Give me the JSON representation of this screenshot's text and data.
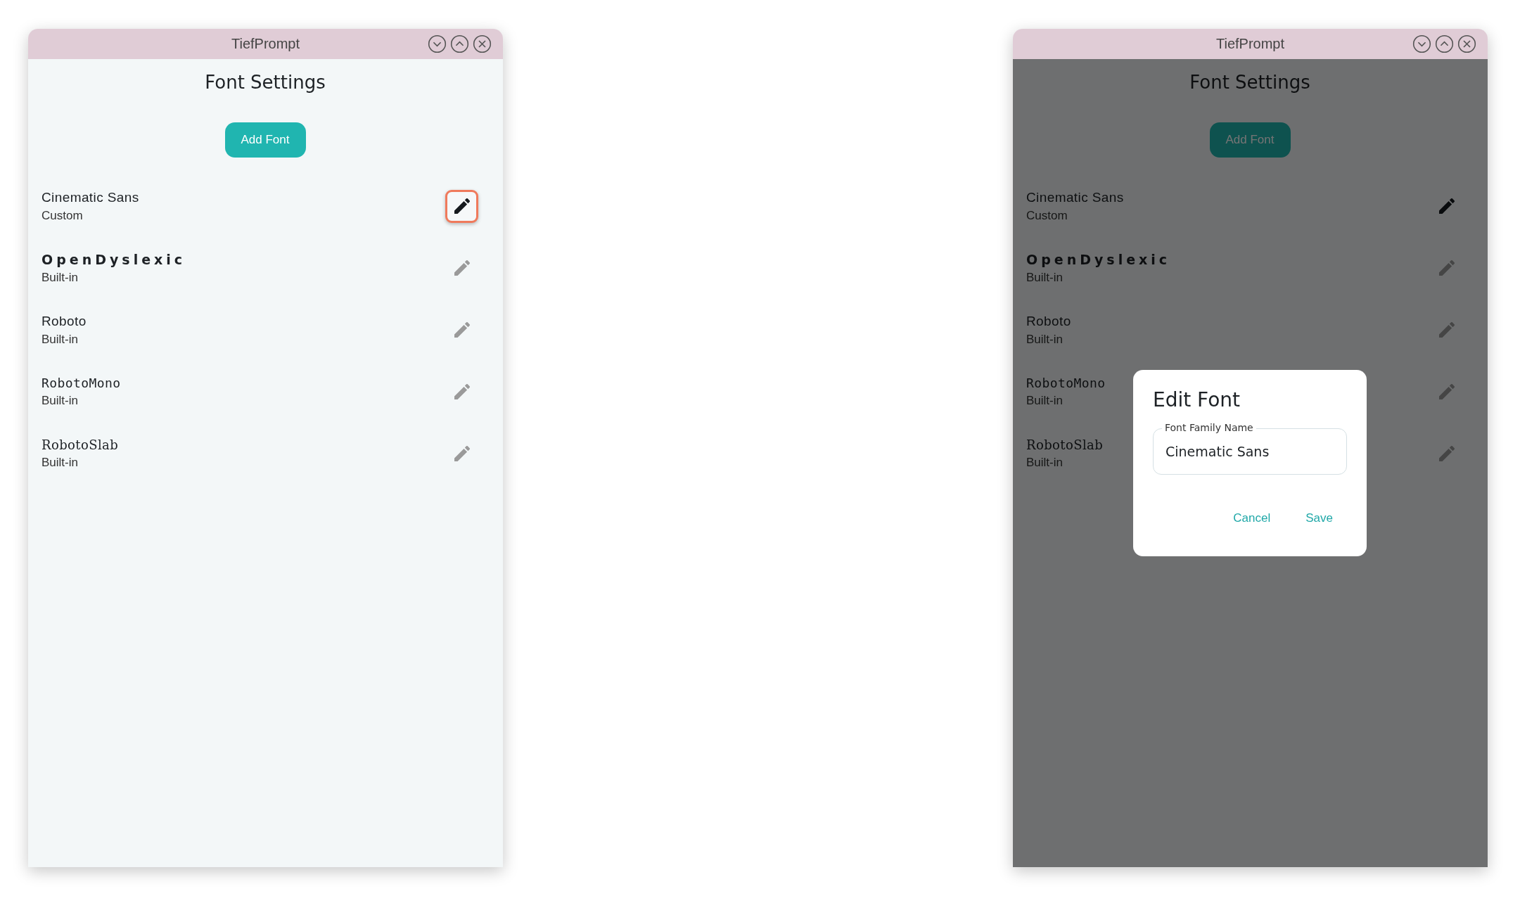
{
  "windows": [
    {
      "title": "TiefPrompt",
      "heading": "Font Settings",
      "add_button": "Add Font",
      "modal_open": false,
      "fonts": [
        {
          "name": "Cinematic Sans",
          "source": "Custom",
          "kind": "sans",
          "disabled": false,
          "focused": true
        },
        {
          "name": "OpenDyslexic",
          "source": "Built-in",
          "kind": "dyslexic",
          "disabled": true,
          "focused": false
        },
        {
          "name": "Roboto",
          "source": "Built-in",
          "kind": "sans",
          "disabled": true,
          "focused": false
        },
        {
          "name": "RobotoMono",
          "source": "Built-in",
          "kind": "mono",
          "disabled": true,
          "focused": false
        },
        {
          "name": "RobotoSlab",
          "source": "Built-in",
          "kind": "slab",
          "disabled": true,
          "focused": false
        }
      ]
    },
    {
      "title": "TiefPrompt",
      "heading": "Font Settings",
      "add_button": "Add Font",
      "modal_open": true,
      "fonts": [
        {
          "name": "Cinematic Sans",
          "source": "Custom",
          "kind": "sans",
          "disabled": false,
          "focused": false
        },
        {
          "name": "OpenDyslexic",
          "source": "Built-in",
          "kind": "dyslexic",
          "disabled": true,
          "focused": false
        },
        {
          "name": "Roboto",
          "source": "Built-in",
          "kind": "sans",
          "disabled": true,
          "focused": false
        },
        {
          "name": "RobotoMono",
          "source": "Built-in",
          "kind": "mono",
          "disabled": true,
          "focused": false
        },
        {
          "name": "RobotoSlab",
          "source": "Built-in",
          "kind": "slab",
          "disabled": true,
          "focused": false
        }
      ],
      "dialog": {
        "title": "Edit Font",
        "field_label": "Font Family Name",
        "field_value": "Cinematic Sans",
        "buttons": [
          "Cancel",
          "Save"
        ]
      }
    }
  ]
}
